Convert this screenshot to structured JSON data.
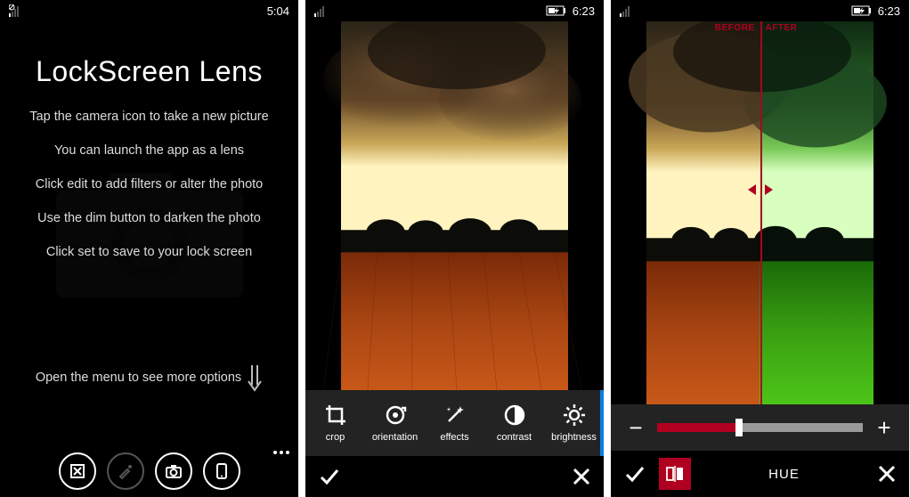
{
  "screen1": {
    "status": {
      "time": "5:04"
    },
    "title": "LockScreen Lens",
    "instructions": [
      "Tap the camera icon to take a new picture",
      "You can launch the app as a lens",
      "Click edit to add filters or alter the photo",
      "Use the dim button to darken the photo",
      "Click set to save to your lock screen"
    ],
    "menu_hint": "Open the menu to see more options"
  },
  "screen2": {
    "status": {
      "time": "6:23"
    },
    "tools": [
      {
        "id": "crop",
        "label": "crop"
      },
      {
        "id": "orientation",
        "label": "orientation"
      },
      {
        "id": "effects",
        "label": "effects"
      },
      {
        "id": "contrast",
        "label": "contrast"
      },
      {
        "id": "brightness",
        "label": "brightness"
      }
    ]
  },
  "screen3": {
    "status": {
      "time": "6:23"
    },
    "before_label": "BEFORE",
    "after_label": "AFTER",
    "adjustment_label": "HUE",
    "slider_value_pct": 40
  },
  "glyphs": {
    "minus": "−",
    "plus": "+"
  }
}
